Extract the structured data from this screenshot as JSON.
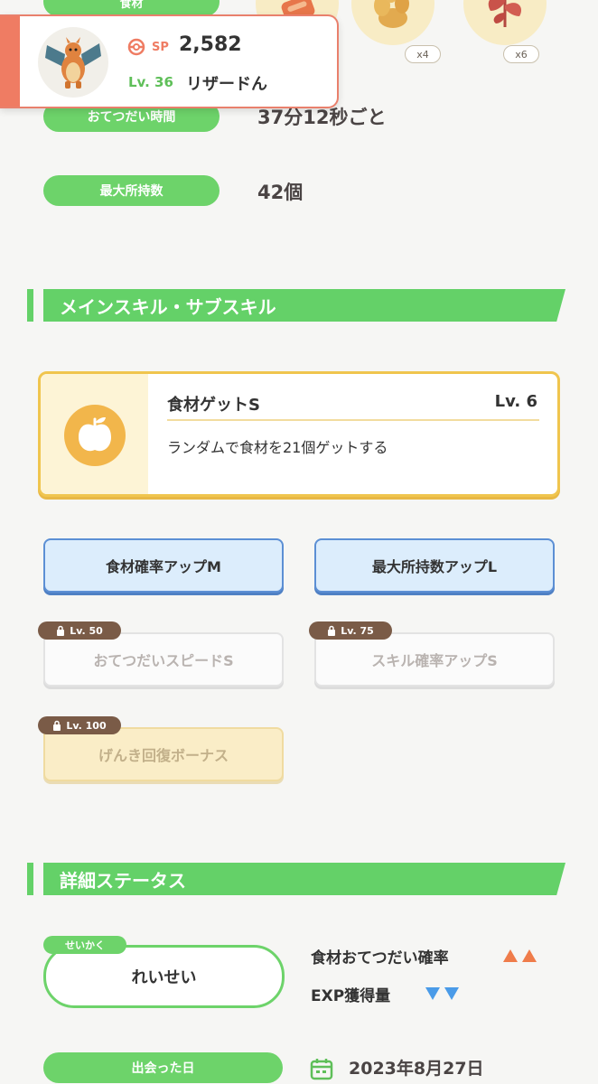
{
  "top_row": {
    "ingredients_label": "食材",
    "ingredient_badges": [
      "x4",
      "x6"
    ]
  },
  "popup": {
    "sp_label": "SP",
    "sp_value": "2,582",
    "level": "Lv. 36",
    "pokemon_name": "リザードん"
  },
  "stats": {
    "help_time_label": "おてつだい時間",
    "help_time_value": "37分12秒ごと",
    "max_carry_label": "最大所持数",
    "max_carry_value": "42個"
  },
  "skills_section": {
    "title": "メインスキル・サブスキル",
    "main_skill": {
      "name": "食材ゲットS",
      "level": "Lv. 6",
      "description": "ランダムで食材を21個ゲットする"
    },
    "sub_skills": [
      {
        "label": "食材確率アップM",
        "lock": ""
      },
      {
        "label": "最大所持数アップL",
        "lock": ""
      },
      {
        "label": "おてつだいスピードS",
        "lock": "Lv. 50"
      },
      {
        "label": "スキル確率アップS",
        "lock": "Lv. 75"
      },
      {
        "label": "げんき回復ボーナス",
        "lock": "Lv. 100"
      }
    ]
  },
  "details_section": {
    "title": "詳細ステータス",
    "nature_tag": "せいかく",
    "nature_value": "れいせい",
    "effect_up": "食材おてつだい確率",
    "effect_down": "EXP獲得量",
    "met_date_label": "出会った日",
    "met_date_value": "2023年8月27日"
  },
  "colors": {
    "green": "#6dd36a",
    "up_arrow": "#ef7c4a",
    "down_arrow": "#4a9be8",
    "popup_accent": "#ef7c63"
  }
}
